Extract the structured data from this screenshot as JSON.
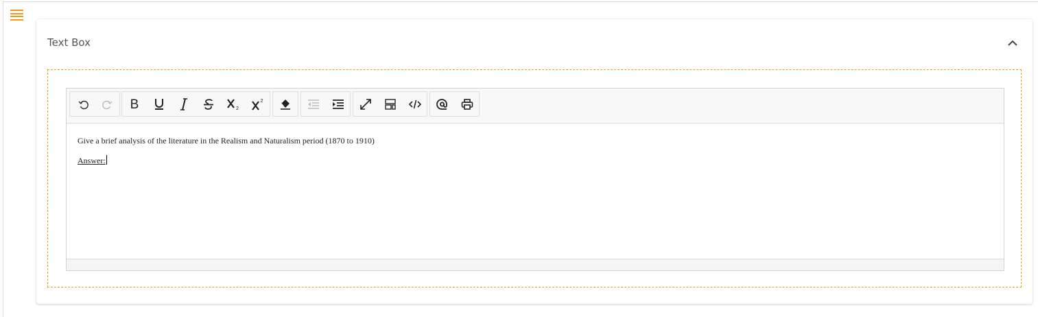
{
  "card": {
    "title": "Text Box"
  },
  "toolbar": {
    "groups": [
      {
        "name": "history",
        "buttons": [
          "undo-icon",
          "redo-icon"
        ]
      },
      {
        "name": "formatting",
        "buttons": [
          "bold-icon",
          "underline-icon",
          "italic-icon",
          "strikethrough-icon",
          "subscript-icon",
          "superscript-icon"
        ]
      },
      {
        "name": "clear",
        "buttons": [
          "eraser-icon"
        ]
      },
      {
        "name": "indent",
        "buttons": [
          "outdent-icon",
          "indent-icon"
        ]
      },
      {
        "name": "view",
        "buttons": [
          "fullscreen-icon",
          "layout-icon",
          "code-view-icon"
        ]
      },
      {
        "name": "misc",
        "buttons": [
          "mention-icon",
          "print-icon"
        ]
      }
    ],
    "disabled": [
      "redo-icon",
      "outdent-icon"
    ]
  },
  "editor": {
    "question": "Give a brief analysis of the literature in the Realism and Naturalism period (1870 to 1910)",
    "answer_label": "Answer:"
  },
  "colors": {
    "accent": "#f29a1d",
    "dashed_border": "#e8a317",
    "toolbar_bg": "#f8f8f8",
    "icon": "#222222",
    "icon_disabled": "#bbbbbb"
  }
}
